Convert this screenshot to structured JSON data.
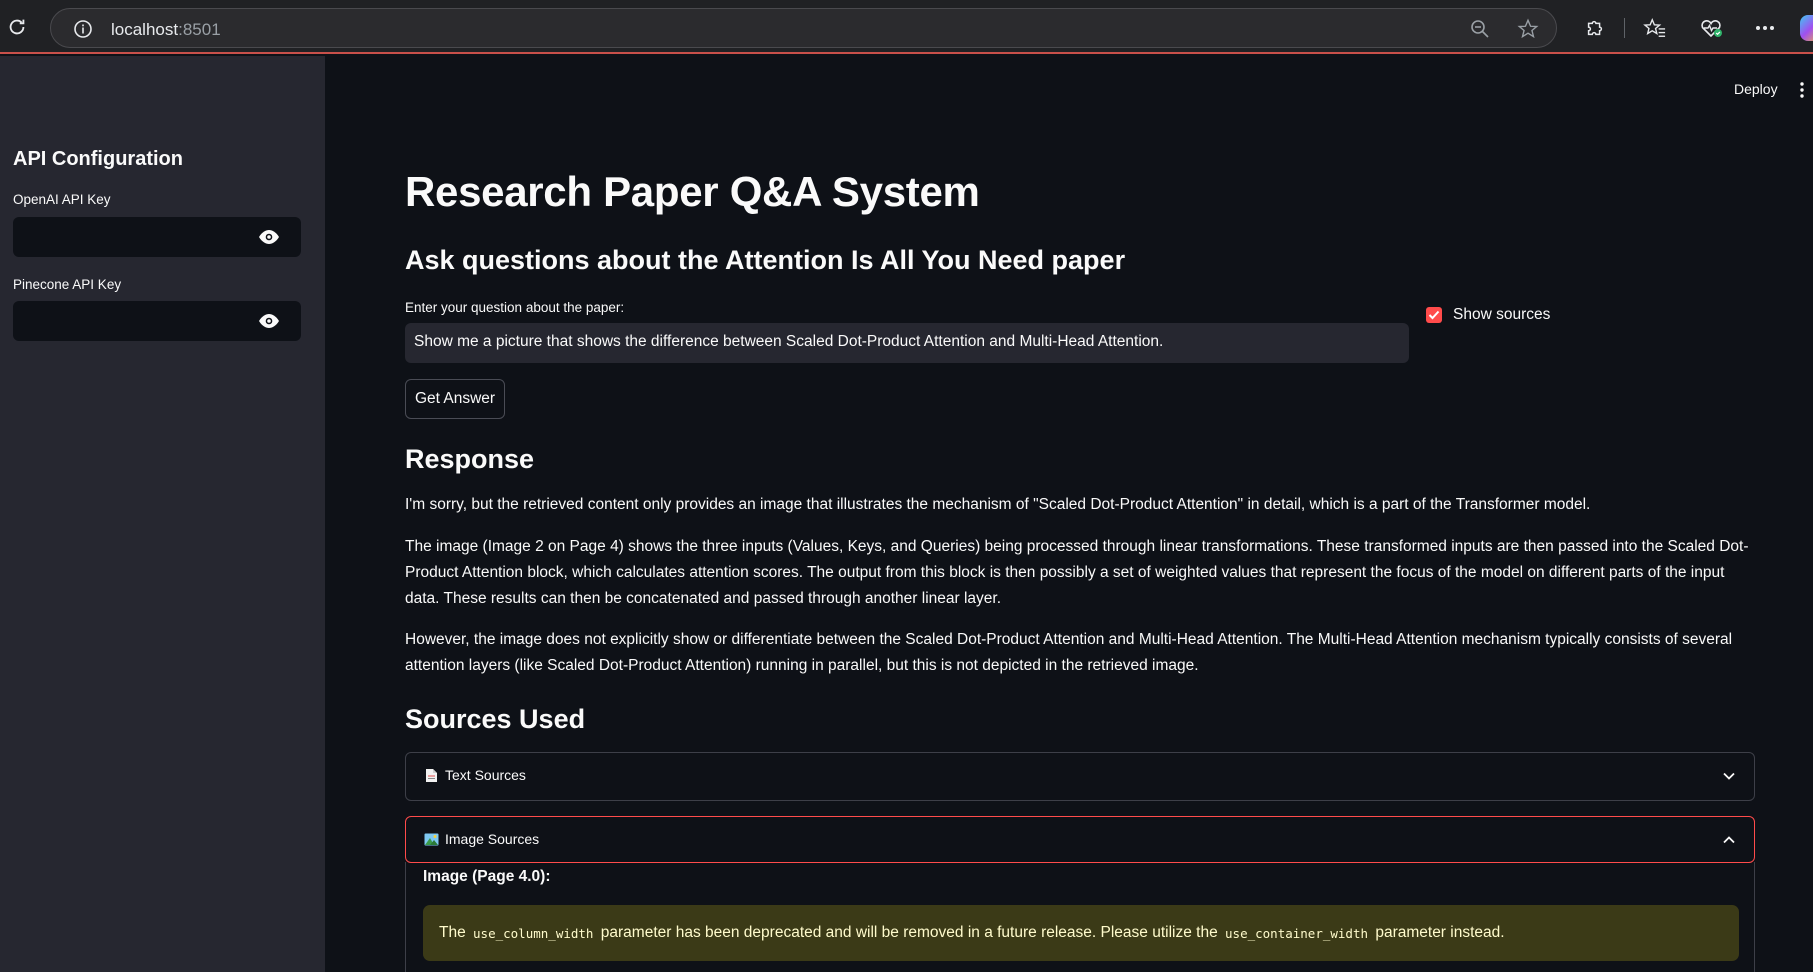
{
  "browser": {
    "url_host": "localhost",
    "url_port": ":8501"
  },
  "sidebar": {
    "title": "API Configuration",
    "fields": [
      {
        "label": "OpenAI API Key",
        "value": ""
      },
      {
        "label": "Pinecone API Key",
        "value": ""
      }
    ]
  },
  "header": {
    "deploy_label": "Deploy"
  },
  "main": {
    "title": "Research Paper Q&A System",
    "subtitle": "Ask questions about the Attention Is All You Need paper",
    "question_label": "Enter your question about the paper:",
    "question_value": "Show me a picture that shows the difference between Scaled Dot-Product Attention and Multi-Head Attention.",
    "show_sources_label": "Show sources",
    "show_sources_checked": true,
    "get_answer_label": "Get Answer",
    "response_heading": "Response",
    "response_paragraphs": [
      "I'm sorry, but the retrieved content only provides an image that illustrates the mechanism of \"Scaled Dot-Product Attention\" in detail, which is a part of the Transformer model.",
      "The image (Image 2 on Page 4) shows the three inputs (Values, Keys, and Queries) being processed through linear transformations. These transformed inputs are then passed into the Scaled Dot-Product Attention block, which calculates attention scores. The output from this block is then possibly a set of weighted values that represent the focus of the model on different parts of the input data. These results can then be concatenated and passed through another linear layer.",
      "However, the image does not explicitly show or differentiate between the Scaled Dot-Product Attention and Multi-Head Attention. The Multi-Head Attention mechanism typically consists of several attention layers (like Scaled Dot-Product Attention) running in parallel, but this is not depicted in the retrieved image."
    ],
    "sources_heading": "Sources Used",
    "text_sources_label": "Text Sources",
    "image_sources_label": "Image Sources",
    "image_caption": "Image (Page 4.0):",
    "warning": {
      "part1": "The",
      "code1": "use_column_width",
      "part2": "parameter has been deprecated and will be removed in a future release. Please utilize the",
      "code2": "use_container_width",
      "part3": "parameter instead."
    }
  },
  "colors": {
    "accent": "#ff4b4b",
    "background": "#0e1117",
    "sidebar": "#262730",
    "warning_bg": "#3b3a17",
    "warning_text": "#fffbcc"
  },
  "icons": {
    "reload": "reload-icon",
    "info": "info-icon",
    "zoom": "zoom-out-icon",
    "favorite": "star-icon",
    "extensions": "puzzle-icon",
    "favorites_list": "favorites-icon",
    "health": "heart-icon",
    "more": "more-icon",
    "eye": "eye-icon",
    "chevron_down": "chevron-down-icon",
    "chevron_up": "chevron-up-icon",
    "text_doc": "document-emoji-icon",
    "image_picture": "picture-emoji-icon"
  }
}
